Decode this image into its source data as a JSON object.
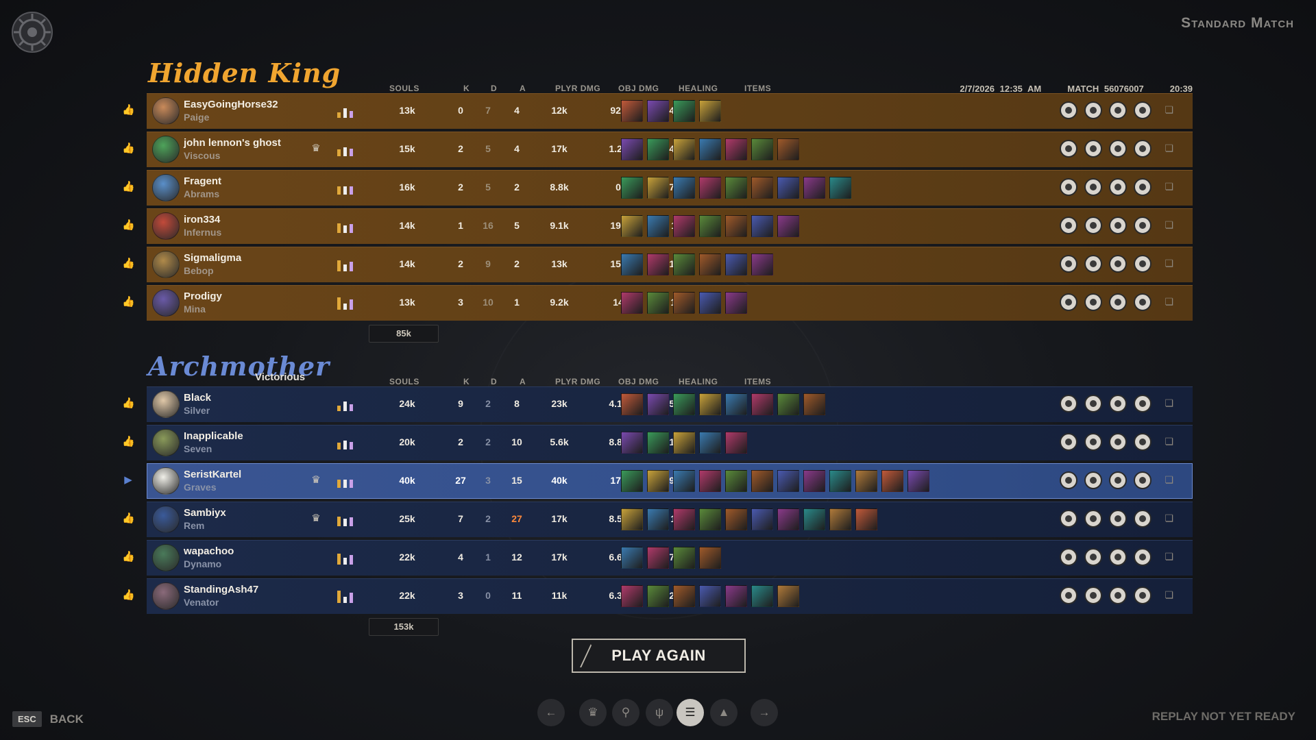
{
  "match_type": "Standard Match",
  "match_info": {
    "date": "2/7/2026 12:35 AM",
    "match_id": "MATCH 56076007",
    "duration": "20:39"
  },
  "columns": {
    "souls": "SOULS",
    "k": "K",
    "d": "D",
    "a": "A",
    "plyr_dmg": "PLYR DMG",
    "obj_dmg": "OBJ DMG",
    "healing": "HEALING",
    "items": "ITEMS"
  },
  "teams": [
    {
      "name": "Hidden King",
      "result": "",
      "color": "#f0a530",
      "total_souls": "85k",
      "players": [
        {
          "name": "EasyGoingHorse32",
          "hero": "Paige",
          "souls": "13k",
          "k": "0",
          "d": "7",
          "a": "4",
          "plyr_dmg": "12k",
          "obj_dmg": "922",
          "healing": "4.2k",
          "items": 4,
          "badge": ""
        },
        {
          "name": "john lennon's ghost",
          "hero": "Viscous",
          "souls": "15k",
          "k": "2",
          "d": "5",
          "a": "4",
          "plyr_dmg": "17k",
          "obj_dmg": "1.2k",
          "healing": "4.7k",
          "items": 7,
          "badge": "rank-icon"
        },
        {
          "name": "Fragent",
          "hero": "Abrams",
          "souls": "16k",
          "k": "2",
          "d": "5",
          "a": "2",
          "plyr_dmg": "8.8k",
          "obj_dmg": "0",
          "healing": "7.4k",
          "items": 9,
          "badge": ""
        },
        {
          "name": "iron334",
          "hero": "Infernus",
          "souls": "14k",
          "k": "1",
          "d": "16",
          "a": "5",
          "plyr_dmg": "9.1k",
          "obj_dmg": "198",
          "healing": "111",
          "items": 7,
          "badge": ""
        },
        {
          "name": "Sigmaligma",
          "hero": "Bebop",
          "souls": "14k",
          "k": "2",
          "d": "9",
          "a": "2",
          "plyr_dmg": "13k",
          "obj_dmg": "152",
          "healing": "1.9k",
          "items": 6,
          "badge": ""
        },
        {
          "name": "Prodigy",
          "hero": "Mina",
          "souls": "13k",
          "k": "3",
          "d": "10",
          "a": "1",
          "plyr_dmg": "9.2k",
          "obj_dmg": "14",
          "healing": "109",
          "items": 5,
          "badge": ""
        }
      ]
    },
    {
      "name": "Archmother",
      "result": "Victorious",
      "color": "#6a8ad4",
      "total_souls": "153k",
      "players": [
        {
          "name": "Black",
          "hero": "Silver",
          "souls": "24k",
          "k": "9",
          "d": "2",
          "a": "8",
          "plyr_dmg": "23k",
          "obj_dmg": "4.1k",
          "healing": "5.9k",
          "items": 8,
          "badge": ""
        },
        {
          "name": "Inapplicable",
          "hero": "Seven",
          "souls": "20k",
          "k": "2",
          "d": "2",
          "a": "10",
          "plyr_dmg": "5.6k",
          "obj_dmg": "8.8k",
          "healing": "1.7k",
          "items": 5,
          "badge": ""
        },
        {
          "name": "SeristKartel",
          "hero": "Graves",
          "souls": "40k",
          "k": "27",
          "d": "3",
          "a": "15",
          "plyr_dmg": "40k",
          "obj_dmg": "17k",
          "healing": "9.5k",
          "items": 12,
          "badge": "rank-icon",
          "me": true
        },
        {
          "name": "Sambiyx",
          "hero": "Rem",
          "souls": "25k",
          "k": "7",
          "d": "2",
          "a": "27",
          "plyr_dmg": "17k",
          "obj_dmg": "8.5k",
          "healing": "12k",
          "items": 10,
          "badge": "rank-icon"
        },
        {
          "name": "wapachoo",
          "hero": "Dynamo",
          "souls": "22k",
          "k": "4",
          "d": "1",
          "a": "12",
          "plyr_dmg": "17k",
          "obj_dmg": "6.6k",
          "healing": "7.6k",
          "items": 4,
          "badge": ""
        },
        {
          "name": "StandingAsh47",
          "hero": "Venator",
          "souls": "22k",
          "k": "3",
          "d": "0",
          "a": "11",
          "plyr_dmg": "11k",
          "obj_dmg": "6.3k",
          "healing": "2.2k",
          "items": 7,
          "badge": ""
        }
      ]
    }
  ],
  "play_again": "PLAY AGAIN",
  "esc_key": "ESC",
  "back_label": "BACK",
  "replay_status": "REPLAY NOT YET READY",
  "nav": [
    "arrow-left-icon",
    "trophy-icon",
    "map-pin-icon",
    "claw-icon",
    "list-icon",
    "chart-icon",
    "arrow-right-icon"
  ]
}
